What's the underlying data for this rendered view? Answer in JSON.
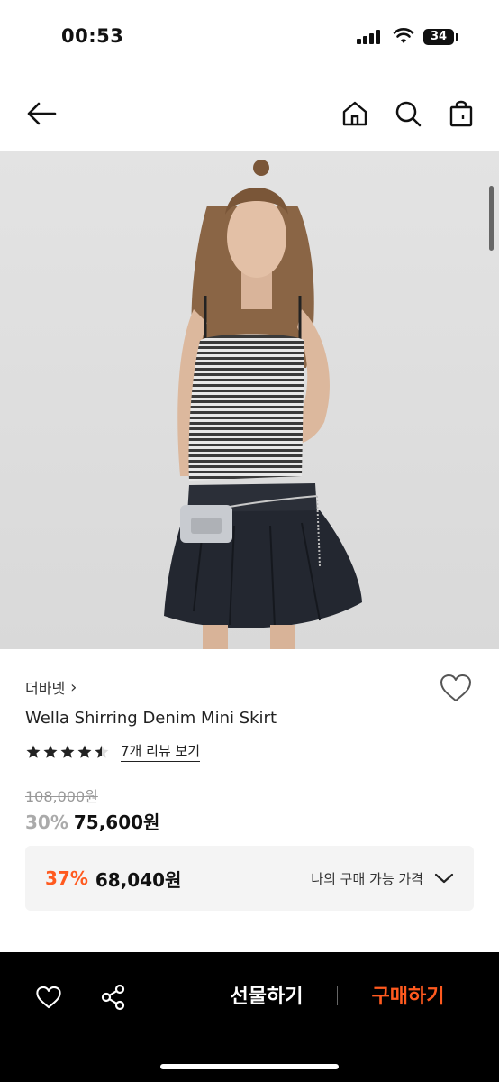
{
  "status": {
    "time": "00:53",
    "battery": "34"
  },
  "nav": {
    "back_icon": "arrow-left-icon",
    "home_icon": "home-icon",
    "search_icon": "search-icon",
    "bag_icon": "shopping-bag-icon"
  },
  "product": {
    "brand": "더바넷",
    "brand_chevron": "›",
    "name": "Wella Shirring Denim Mini Skirt",
    "rating_stars": 4.5,
    "review_link": "7개 리뷰 보기",
    "original_price": "108,000원",
    "discount": "30%",
    "sale_price": "75,600원"
  },
  "member_price": {
    "discount": "37%",
    "price": "68,040원",
    "label": "나의 구매 가능 가격"
  },
  "bottom_bar": {
    "gift_label": "선물하기",
    "buy_label": "구매하기"
  },
  "colors": {
    "accent": "#ff5a1f",
    "bottom_bg": "#000000"
  }
}
